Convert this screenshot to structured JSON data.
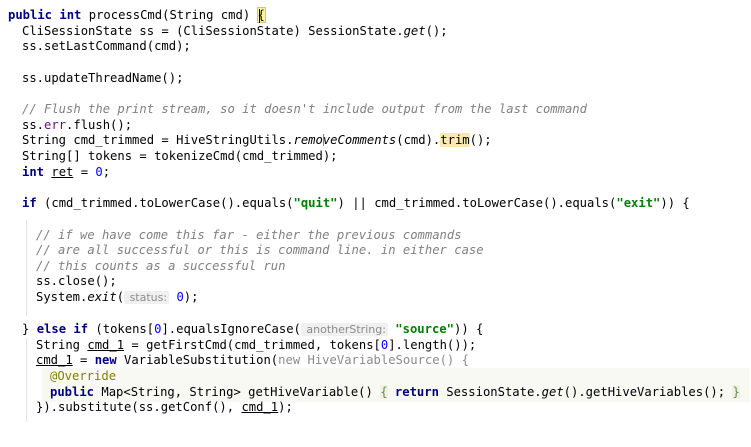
{
  "editor": {
    "lines": [
      [
        "public",
        " ",
        "int",
        " processCmd(String cmd) ",
        "{"
      ],
      [
        "CliSessionState ss = (CliSessionState) SessionState.",
        "get",
        "();"
      ],
      [
        "ss.setLastCommand(cmd);"
      ],
      [
        ""
      ],
      [
        "ss.updateThreadName();"
      ],
      [
        ""
      ],
      [
        "// Flush the print stream, so it doesn't include output from the last command"
      ],
      [
        "ss.",
        "err",
        ".flush();"
      ],
      [
        "String cmd_trimmed = HiveStringUtils.",
        "removeComments",
        "(cmd).",
        "trim",
        "();"
      ],
      [
        "String[] tokens = tokenizeCmd(cmd_trimmed);"
      ],
      [
        "int",
        " ",
        "ret",
        " = ",
        "0",
        ";"
      ],
      [
        ""
      ],
      [
        "if",
        " (cmd_trimmed.toLowerCase().equals(",
        "\"quit\"",
        ") || cmd_trimmed.toLowerCase().equals(",
        "\"exit\"",
        ")) {"
      ],
      [
        ""
      ],
      [
        "// if we have come this far - either the previous commands"
      ],
      [
        "// are all successful or this is command line. in either case"
      ],
      [
        "// this counts as a successful run"
      ],
      [
        "ss.close();"
      ],
      [
        "System.",
        "exit",
        "(",
        " status:",
        " ",
        "0",
        ");"
      ],
      [
        ""
      ],
      [
        "} ",
        "else if",
        " (tokens[",
        "0",
        "].equalsIgnoreCase(",
        " anotherString:",
        " ",
        "\"source\"",
        ")) {"
      ],
      [
        "String ",
        "cmd_1",
        " = getFirstCmd(cmd_trimmed, tokens[",
        "0",
        "].length());"
      ],
      [
        "cmd_1",
        " = ",
        "new",
        " VariableSubstitution(",
        "new",
        " HiveVariableSource() {"
      ],
      [
        "@Override"
      ],
      [
        "public",
        " Map<String, String> getHiveVariable() ",
        "{",
        " ",
        "return",
        " SessionState.",
        "get",
        "().getHiveVariables(); ",
        "}"
      ],
      [
        "}).substitute(ss.getConf(), ",
        "cmd_1",
        ");"
      ]
    ]
  }
}
